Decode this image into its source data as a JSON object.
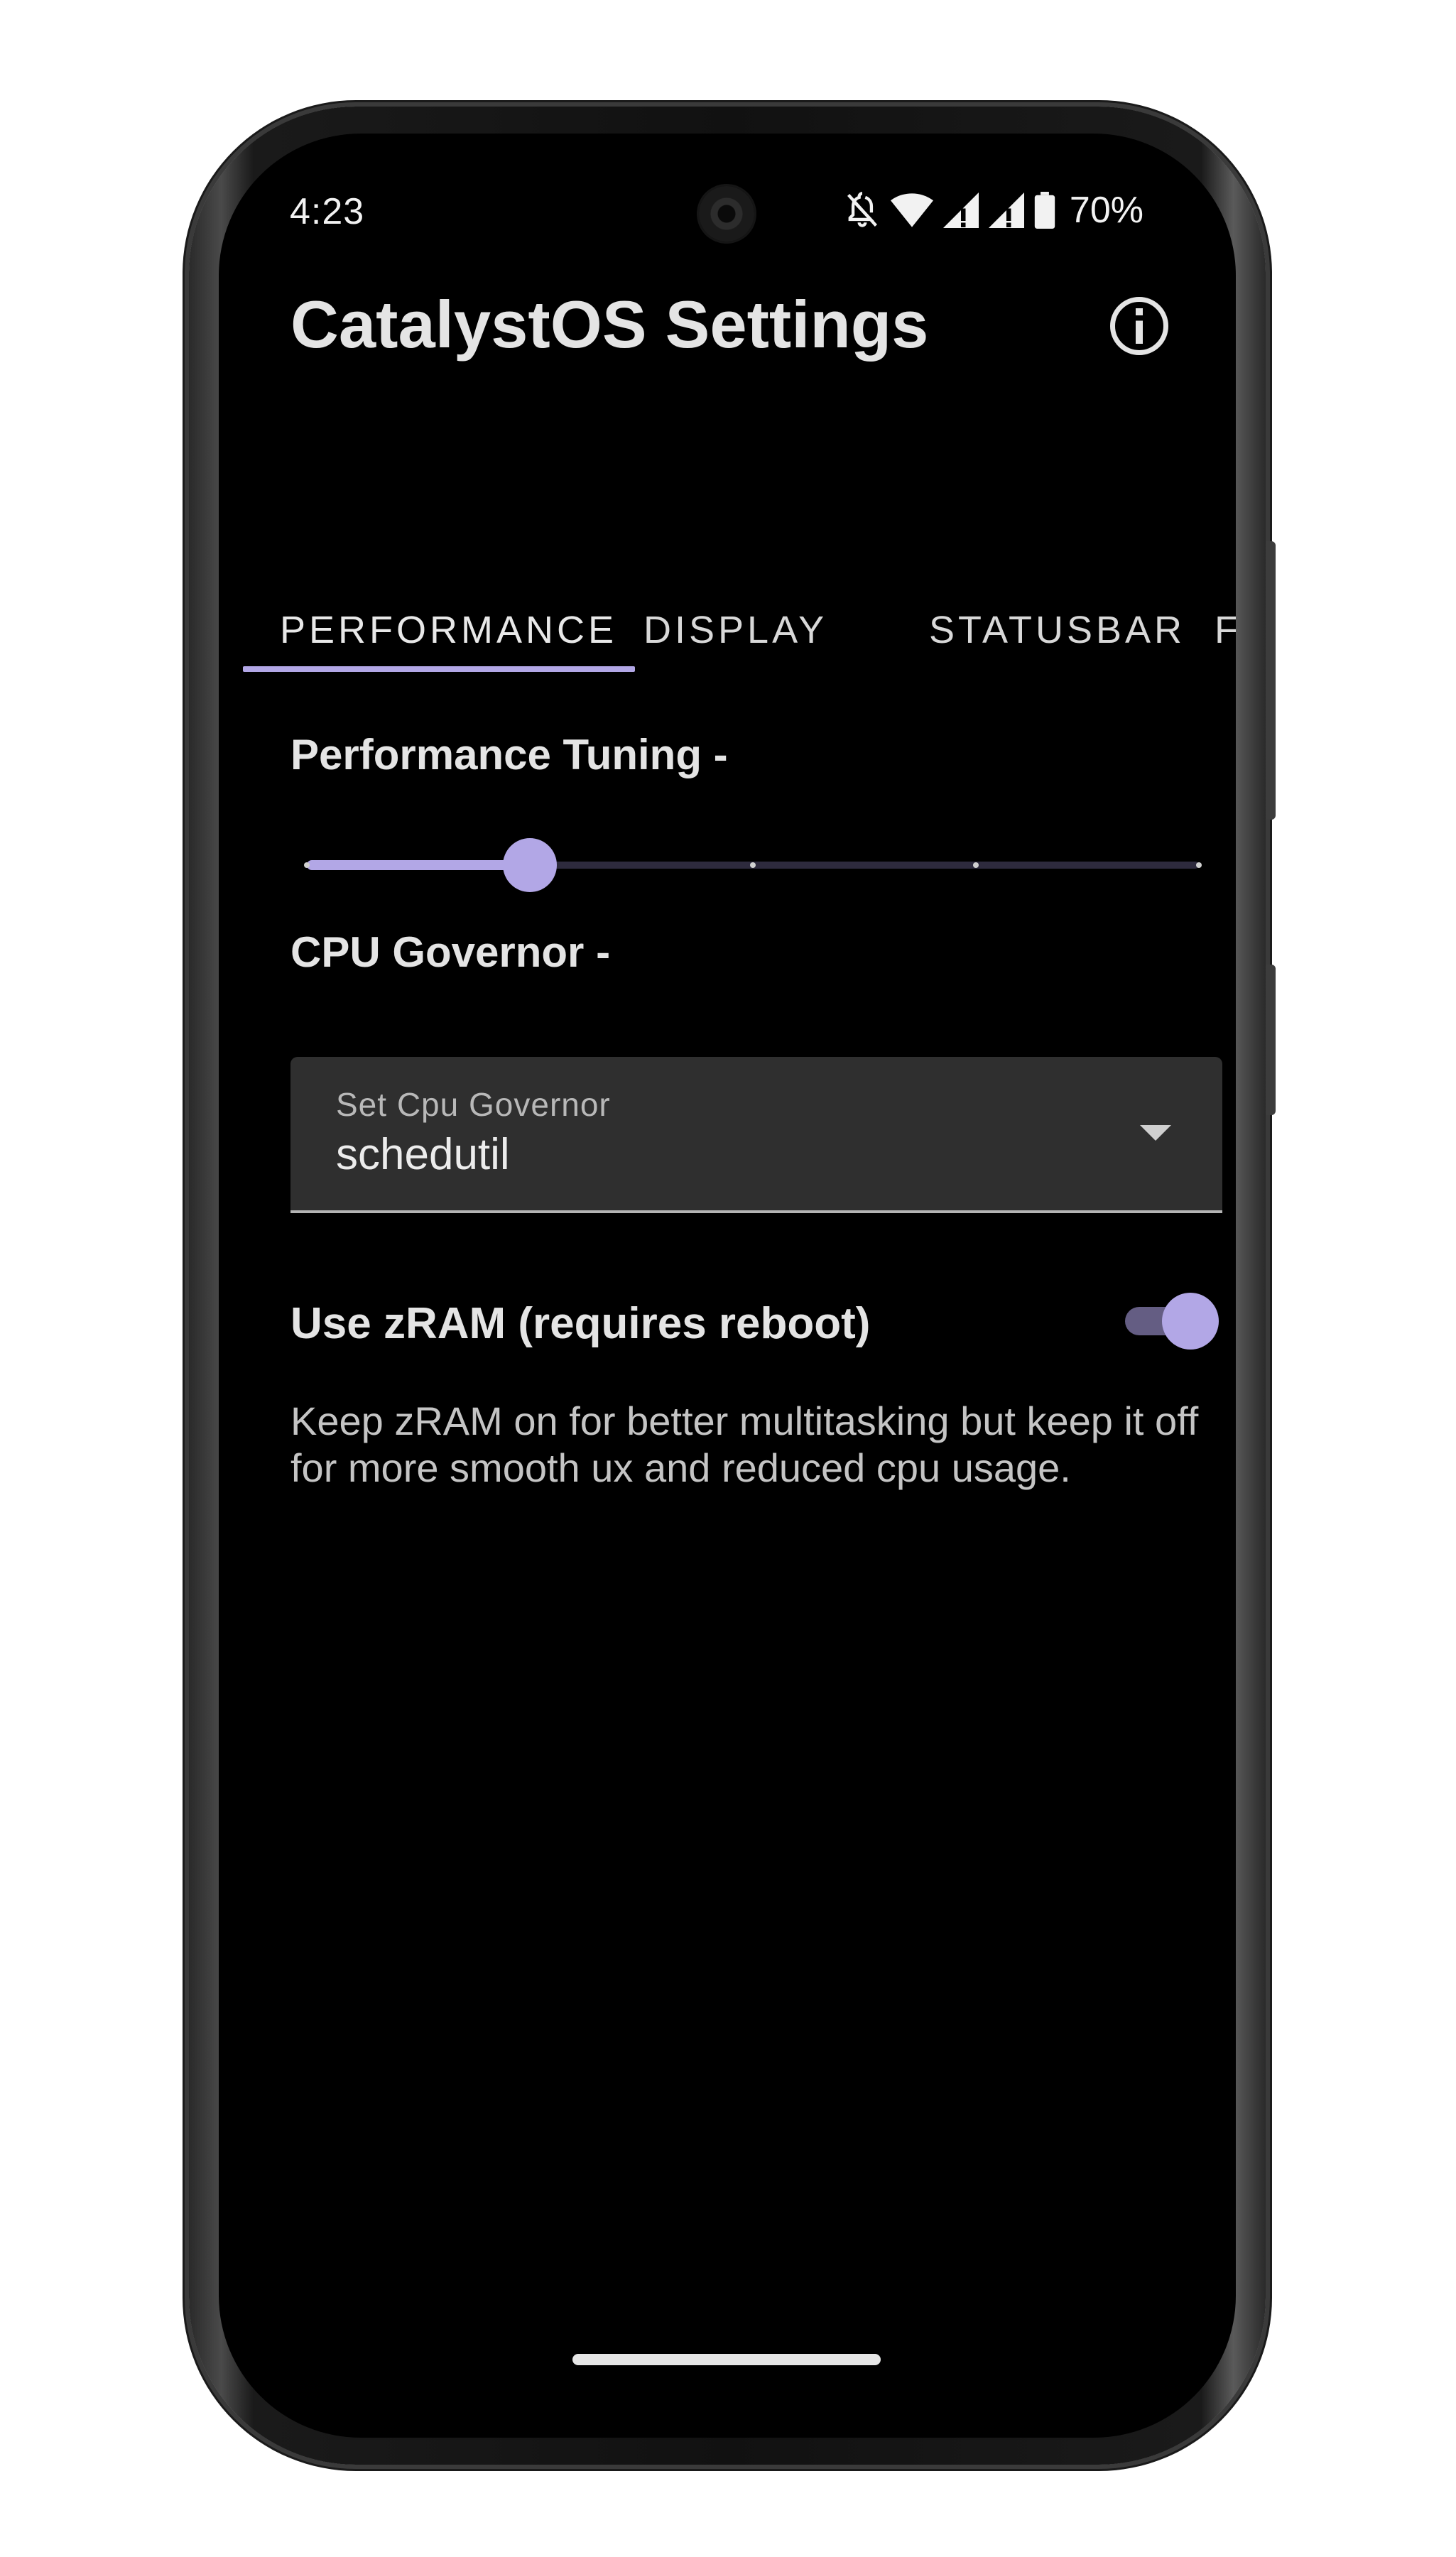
{
  "status_bar": {
    "time": "4:23",
    "battery": "70%",
    "icons": [
      "do-not-disturb-bell-off-icon",
      "wifi-icon",
      "cell-signal-1-icon",
      "cell-signal-2-icon",
      "battery-icon"
    ]
  },
  "app_bar": {
    "title": "CatalystOS Settings",
    "info_icon": "info-icon"
  },
  "tabs": [
    {
      "label": "PERFORMANCE",
      "selected": true
    },
    {
      "label": "DISPLAY",
      "selected": false
    },
    {
      "label": "STATUSBAR",
      "selected": false
    },
    {
      "label": "F",
      "selected": false
    }
  ],
  "performance": {
    "tuning_label": "Performance Tuning -",
    "slider": {
      "steps": 5,
      "value_index": 1,
      "value_fraction": 0.25
    }
  },
  "cpu": {
    "label": "CPU Governor -",
    "dropdown_label": "Set Cpu Governor",
    "dropdown_value": "schedutil"
  },
  "zram": {
    "label": "Use zRAM (requires reboot)",
    "enabled": true,
    "description": "Keep zRAM on for better multitasking but keep it off for more smooth ux and reduced cpu usage."
  },
  "colors": {
    "accent": "#b2a7e6",
    "background": "#000000",
    "surface": "#2f2f2f",
    "text_primary": "#e4e4e4",
    "text_secondary": "#c4c4c4"
  }
}
